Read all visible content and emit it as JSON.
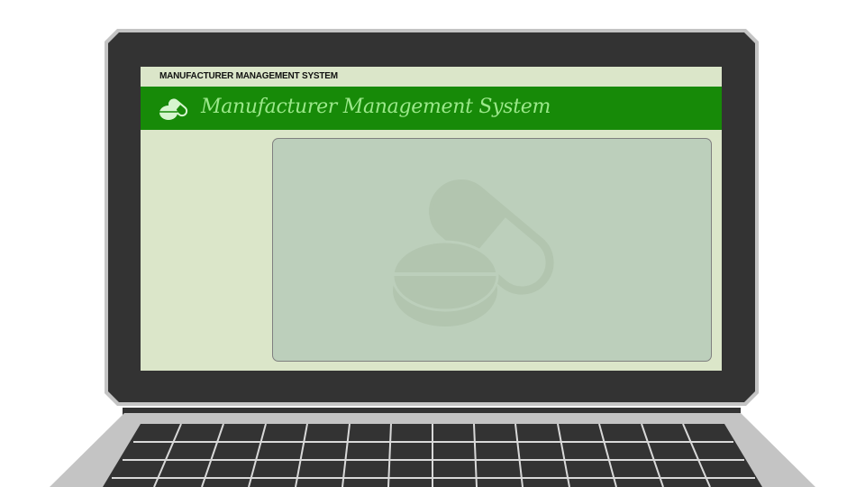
{
  "window": {
    "title": "MANUFACTURER MANAGEMENT SYSTEM"
  },
  "header": {
    "app_icon": "pills-icon",
    "title": "Manufacturer Management System"
  },
  "main": {
    "watermark_icon": "pill-capsule-icon"
  },
  "colors": {
    "header_bg": "#178a08",
    "header_text": "#9be88a",
    "screen_bg": "#dbe6c9",
    "panel_bg": "#bccfbb",
    "bezel": "#333333"
  }
}
